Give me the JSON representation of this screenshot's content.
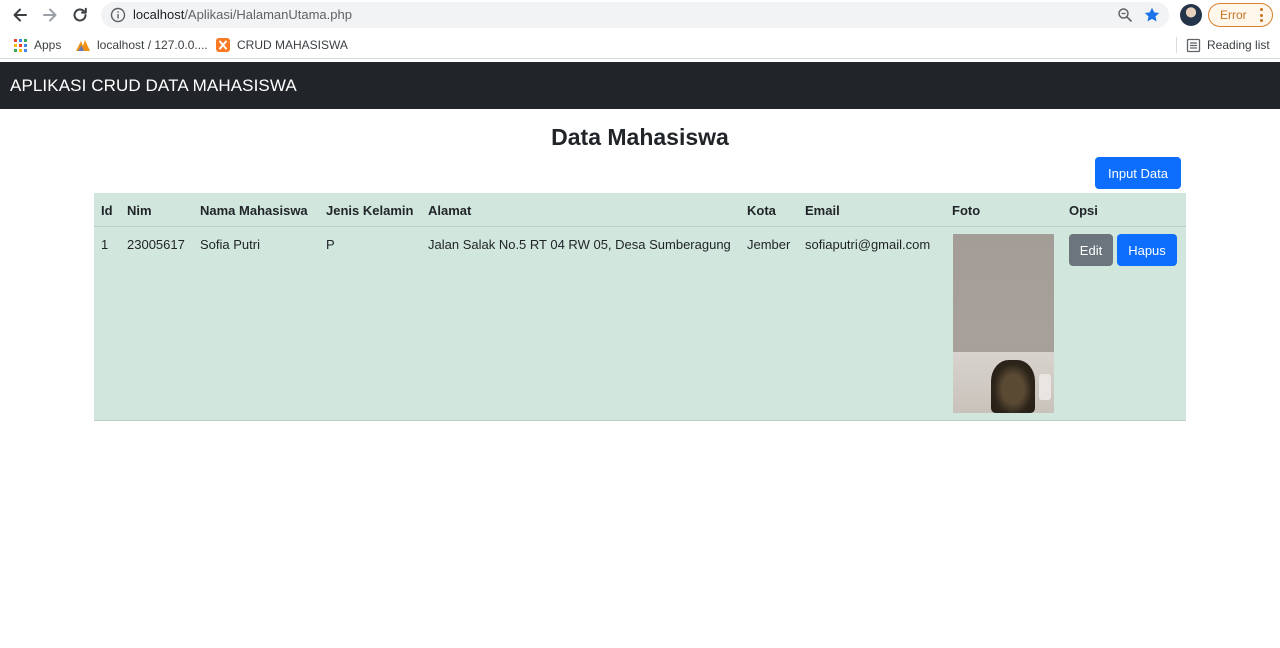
{
  "browser": {
    "url_host": "localhost",
    "url_path": "/Aplikasi/HalamanUtama.php",
    "profile_status": "Error",
    "bookmarks": [
      {
        "label": "Apps",
        "icon": "apps-grid-icon"
      },
      {
        "label": "localhost / 127.0.0....",
        "icon": "phpmyadmin-icon"
      },
      {
        "label": "CRUD MAHASISWA",
        "icon": "xampp-icon"
      }
    ],
    "reading_list_label": "Reading list"
  },
  "navbar": {
    "brand": "APLIKASI CRUD DATA MAHASISWA"
  },
  "main": {
    "title": "Data Mahasiswa",
    "input_button": "Input Data"
  },
  "table": {
    "headers": [
      "Id",
      "Nim",
      "Nama Mahasiswa",
      "Jenis Kelamin",
      "Alamat",
      "Kota",
      "Email",
      "Foto",
      "Opsi"
    ],
    "rows": [
      {
        "id": "1",
        "nim": "23005617",
        "nama": "Sofia Putri",
        "jk": "P",
        "alamat": "Jalan Salak No.5 RT 04 RW 05, Desa Sumberagung",
        "kota": "Jember",
        "email": "sofiaputri@gmail.com",
        "edit_label": "Edit",
        "delete_label": "Hapus"
      }
    ]
  },
  "colors": {
    "navbar_bg": "#212529",
    "primary": "#0d6efd",
    "secondary": "#6c757d",
    "table_success_bg": "#d1e7dd"
  }
}
